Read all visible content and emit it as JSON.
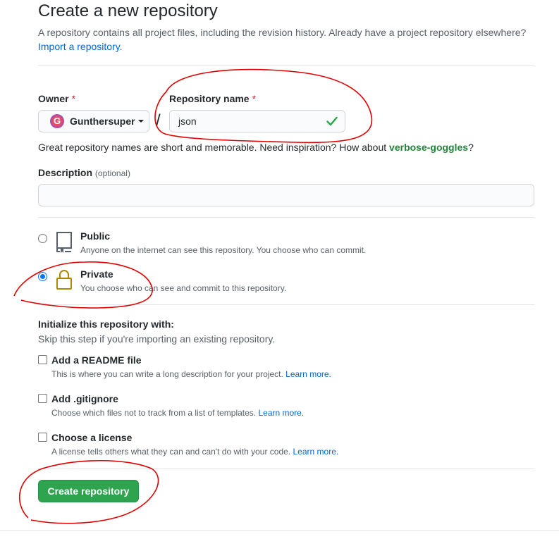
{
  "header": {
    "title": "Create a new repository",
    "intro": "A repository contains all project files, including the revision history. Already have a project repository elsewhere?",
    "import_link": "Import a repository."
  },
  "owner": {
    "label": "Owner",
    "required_mark": "*",
    "value": "Gunthersuper",
    "avatar_letter": "G"
  },
  "slash": "/",
  "repo_name": {
    "label": "Repository name",
    "required_mark": "*",
    "value": "json",
    "status": "valid"
  },
  "suggestion": {
    "text": "Great repository names are short and memorable. Need inspiration? How about",
    "name": "verbose-goggles",
    "end": "?"
  },
  "description": {
    "label": "Description",
    "optional": "(optional)",
    "value": ""
  },
  "visibility": {
    "selected": "private",
    "public": {
      "title": "Public",
      "desc": "Anyone on the internet can see this repository. You choose who can commit."
    },
    "private": {
      "title": "Private",
      "desc": "You choose who can see and commit to this repository."
    }
  },
  "initialize": {
    "heading": "Initialize this repository with:",
    "subheading": "Skip this step if you're importing an existing repository.",
    "options": [
      {
        "title": "Add a README file",
        "desc": "This is where you can write a long description for your project.",
        "link": "Learn more.",
        "checked": false
      },
      {
        "title": "Add .gitignore",
        "desc": "Choose which files not to track from a list of templates.",
        "link": "Learn more.",
        "checked": false
      },
      {
        "title": "Choose a license",
        "desc": "A license tells others what they can and can't do with your code.",
        "link": "Learn more.",
        "checked": false
      }
    ]
  },
  "create_button": "Create repository",
  "colors": {
    "accent_green": "#2ea44f",
    "link_blue": "#0366d6",
    "annotation_red": "#e00000"
  }
}
